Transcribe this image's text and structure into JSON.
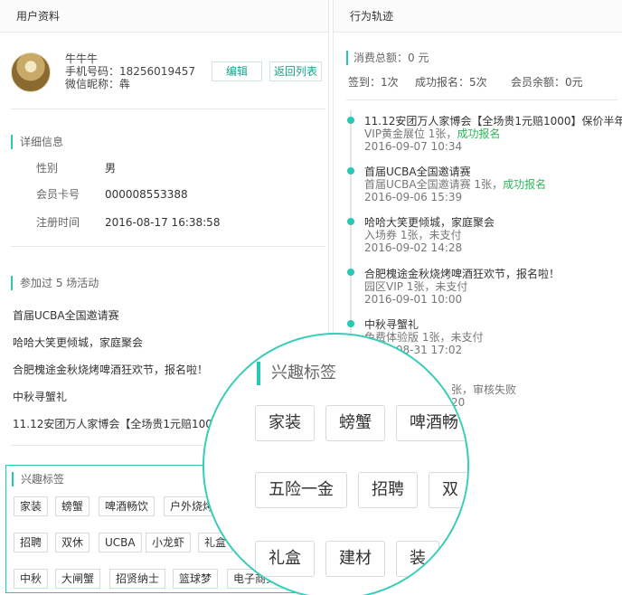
{
  "left": {
    "header": "用户资料",
    "user": {
      "name": "牛牛牛",
      "phone": "手机号码：18256019457",
      "wechat": "微信昵称：犇",
      "edit_label": "编辑",
      "back_label": "返回列表"
    },
    "details": {
      "title": "详细信息",
      "rows": [
        {
          "label": "性别",
          "value": "男"
        },
        {
          "label": "会员卡号",
          "value": "000008553388"
        },
        {
          "label": "注册时间",
          "value": "2016-08-17 16:38:58"
        }
      ]
    },
    "activities": {
      "title": "参加过 5 场活动",
      "items": [
        "首届UCBA全国邀请赛",
        "哈哈大笑更倾城，家庭聚会",
        "合肥槐途金秋烧烤啤酒狂欢节，报名啦！",
        "中秋寻蟹礼",
        "11.12安团万人家博会【全场贵1元赔1000】"
      ]
    },
    "tags": {
      "title": "兴趣标签",
      "items": [
        "家装",
        "螃蟹",
        "啤酒畅饮",
        "户外烧烤",
        "招聘",
        "双休",
        "UCBA",
        "小龙虾",
        "礼盒",
        "中秋",
        "大闸蟹",
        "招贤纳士",
        "篮球梦",
        "电子商务"
      ]
    }
  },
  "right": {
    "header": "行为轨迹",
    "stats": {
      "total_label": "消费总额：",
      "total_value": "0 元",
      "checkin": "签到：1次",
      "signup": "成功报名：5次",
      "balance": "会员余额：0元"
    },
    "timeline": [
      {
        "title": "11.12安团万人家博会【全场贵1元赔1000】保价半年",
        "sub": "VIP黄金展位 1张，",
        "status": "成功报名",
        "time": "2016-09-07 10:34"
      },
      {
        "title": "首届UCBA全国邀请赛",
        "sub": "首届UCBA全国邀请赛 1张，",
        "status": "成功报名",
        "time": "2016-09-06 15:39"
      },
      {
        "title": "哈哈大笑更倾城，家庭聚会",
        "sub": "入场券 1张，未支付",
        "status": "",
        "time": "2016-09-02 14:28"
      },
      {
        "title": "合肥槐途金秋烧烤啤酒狂欢节，报名啦！",
        "sub": "园区VIP 1张，未支付",
        "status": "",
        "time": "2016-09-01 10:00"
      },
      {
        "title": "中秋寻蟹礼",
        "sub": "免费体验版 1张，未支付",
        "status": "",
        "time": "2016-08-31 17:02"
      },
      {
        "title": "",
        "sub": "张，审核失败",
        "status": "",
        "time": "20"
      }
    ]
  },
  "magnifier": {
    "title": "兴趣标签",
    "tags": [
      "家装",
      "螃蟹",
      "啤酒畅",
      "五险一金",
      "招聘",
      "双",
      "礼盒",
      "建材",
      "装"
    ]
  },
  "colors": {
    "accent": "#28c8b2",
    "success": "#2db75b"
  }
}
